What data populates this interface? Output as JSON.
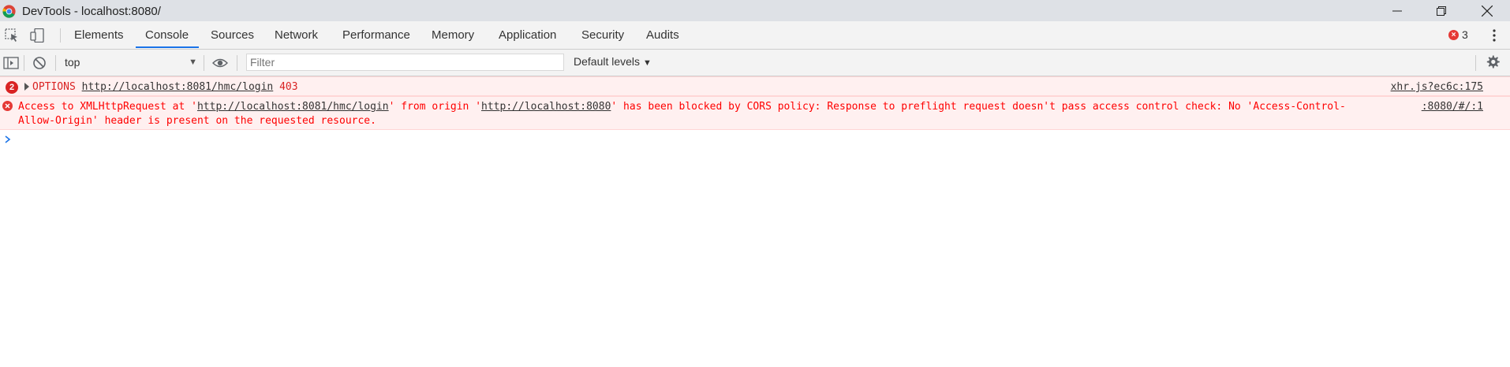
{
  "window": {
    "title": "DevTools - localhost:8080/",
    "minimize_icon": "minimize-icon",
    "maximize_icon": "restore-icon",
    "close_icon": "close-icon"
  },
  "tabs": {
    "items": [
      "Elements",
      "Console",
      "Sources",
      "Network",
      "Performance",
      "Memory",
      "Application",
      "Security",
      "Audits"
    ],
    "active": "Console",
    "error_count": "3",
    "accent_color": "#1a73e8"
  },
  "toolbar": {
    "context": "top",
    "filter_placeholder": "Filter",
    "levels": "Default levels"
  },
  "console": {
    "messages": [
      {
        "count": "2",
        "prefix": "OPTIONS ",
        "url": "http://localhost:8081/hmc/login",
        "suffix": " 403",
        "source": "xhr.js?ec6c:175"
      },
      {
        "part1": "Access to XMLHttpRequest at '",
        "url1": "http://localhost:8081/hmc/login",
        "part2": "' from origin '",
        "url2": "http://localhost:8080",
        "part3": "' has been blocked by CORS policy: Response to preflight request doesn't pass access control check: No 'Access-Control-Allow-Origin' header is present on the requested resource.",
        "source": ":8080/#/:1"
      }
    ],
    "error_color": "#ff0000",
    "error_bg": "#fff0f0"
  }
}
